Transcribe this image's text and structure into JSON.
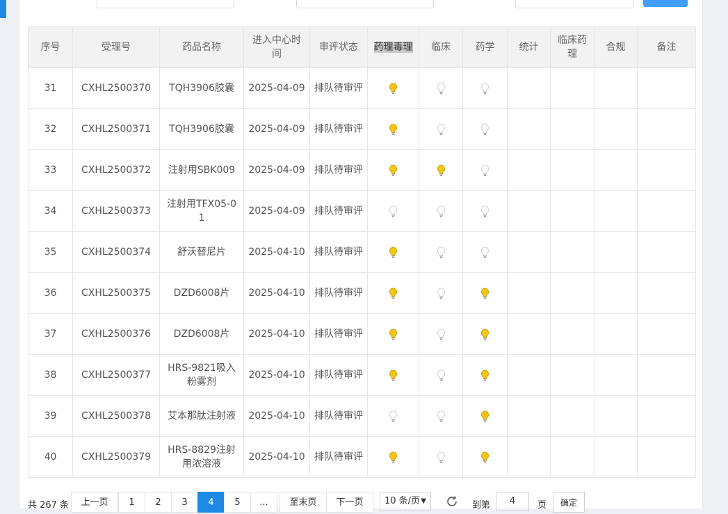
{
  "colors": {
    "accent": "#1e88e5",
    "bulb_on": "#f5c518",
    "bulb_off": "#cfcfcf"
  },
  "table": {
    "headers": [
      {
        "key": "seq",
        "label": "序号"
      },
      {
        "key": "accept_no",
        "label": "受理号"
      },
      {
        "key": "drug_name",
        "label": "药品名称"
      },
      {
        "key": "enter_time",
        "label": "进入中心时间"
      },
      {
        "key": "status",
        "label": "审评状态"
      },
      {
        "key": "pharmacology",
        "label": "药理毒理"
      },
      {
        "key": "clinical",
        "label": "临床"
      },
      {
        "key": "pharmacy",
        "label": "药学"
      },
      {
        "key": "statistics",
        "label": "统计"
      },
      {
        "key": "clinical_pharmacology",
        "label": "临床药理"
      },
      {
        "key": "compliance",
        "label": "合规"
      },
      {
        "key": "remarks",
        "label": "备注"
      }
    ],
    "rows": [
      {
        "seq": "31",
        "accept_no": "CXHL2500370",
        "drug_name": "TQH3906胶囊",
        "enter_time": "2025-04-09",
        "status": "排队待审评",
        "pharmacology": "lightbulb-on",
        "clinical": "lightbulb-off",
        "pharmacy": "lightbulb-off",
        "statistics": "",
        "clinical_pharmacology": "",
        "compliance": "",
        "remarks": ""
      },
      {
        "seq": "32",
        "accept_no": "CXHL2500371",
        "drug_name": "TQH3906胶囊",
        "enter_time": "2025-04-09",
        "status": "排队待审评",
        "pharmacology": "lightbulb-on",
        "clinical": "lightbulb-off",
        "pharmacy": "lightbulb-off",
        "statistics": "",
        "clinical_pharmacology": "",
        "compliance": "",
        "remarks": ""
      },
      {
        "seq": "33",
        "accept_no": "CXHL2500372",
        "drug_name": "注射用SBK009",
        "enter_time": "2025-04-09",
        "status": "排队待审评",
        "pharmacology": "lightbulb-on",
        "clinical": "lightbulb-on",
        "pharmacy": "lightbulb-off",
        "statistics": "",
        "clinical_pharmacology": "",
        "compliance": "",
        "remarks": ""
      },
      {
        "seq": "34",
        "accept_no": "CXHL2500373",
        "drug_name": "注射用TFX05-01",
        "enter_time": "2025-04-09",
        "status": "排队待审评",
        "pharmacology": "lightbulb-off",
        "clinical": "lightbulb-off",
        "pharmacy": "lightbulb-off",
        "statistics": "",
        "clinical_pharmacology": "",
        "compliance": "",
        "remarks": ""
      },
      {
        "seq": "35",
        "accept_no": "CXHL2500374",
        "drug_name": "舒沃替尼片",
        "enter_time": "2025-04-10",
        "status": "排队待审评",
        "pharmacology": "lightbulb-on",
        "clinical": "lightbulb-off",
        "pharmacy": "lightbulb-off",
        "statistics": "",
        "clinical_pharmacology": "",
        "compliance": "",
        "remarks": ""
      },
      {
        "seq": "36",
        "accept_no": "CXHL2500375",
        "drug_name": "DZD6008片",
        "enter_time": "2025-04-10",
        "status": "排队待审评",
        "pharmacology": "lightbulb-on",
        "clinical": "lightbulb-off",
        "pharmacy": "lightbulb-on",
        "statistics": "",
        "clinical_pharmacology": "",
        "compliance": "",
        "remarks": ""
      },
      {
        "seq": "37",
        "accept_no": "CXHL2500376",
        "drug_name": "DZD6008片",
        "enter_time": "2025-04-10",
        "status": "排队待审评",
        "pharmacology": "lightbulb-on",
        "clinical": "lightbulb-off",
        "pharmacy": "lightbulb-on",
        "statistics": "",
        "clinical_pharmacology": "",
        "compliance": "",
        "remarks": ""
      },
      {
        "seq": "38",
        "accept_no": "CXHL2500377",
        "drug_name": "HRS-9821吸入粉雾剂",
        "enter_time": "2025-04-10",
        "status": "排队待审评",
        "pharmacology": "lightbulb-on",
        "clinical": "lightbulb-off",
        "pharmacy": "lightbulb-on",
        "statistics": "",
        "clinical_pharmacology": "",
        "compliance": "",
        "remarks": ""
      },
      {
        "seq": "39",
        "accept_no": "CXHL2500378",
        "drug_name": "艾本那肽注射液",
        "enter_time": "2025-04-10",
        "status": "排队待审评",
        "pharmacology": "lightbulb-off",
        "clinical": "lightbulb-off",
        "pharmacy": "lightbulb-on",
        "statistics": "",
        "clinical_pharmacology": "",
        "compliance": "",
        "remarks": ""
      },
      {
        "seq": "40",
        "accept_no": "CXHL2500379",
        "drug_name": "HRS-8829注射用浓溶液",
        "enter_time": "2025-04-10",
        "status": "排队待审评",
        "pharmacology": "lightbulb-on",
        "clinical": "lightbulb-off",
        "pharmacy": "lightbulb-on",
        "statistics": "",
        "clinical_pharmacology": "",
        "compliance": "",
        "remarks": ""
      }
    ]
  },
  "pagination": {
    "total_text": "共 267 条",
    "prev_label": "上一页",
    "pages": [
      "1",
      "2",
      "3",
      "4",
      "5",
      "..."
    ],
    "current_page": "4",
    "last_label": "至末页",
    "next_label": "下一页",
    "page_size_text": "10 条/页",
    "refresh_icon": "refresh-icon",
    "goto_prefix": "到第",
    "goto_value": "4",
    "goto_suffix": "页",
    "confirm_label": "确定"
  }
}
